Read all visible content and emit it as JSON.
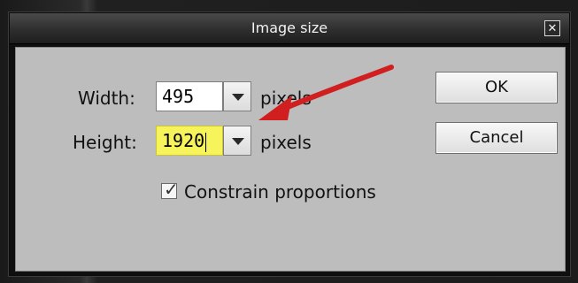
{
  "dialog": {
    "title": "Image size",
    "close_label": "✕"
  },
  "form": {
    "width_label": "Width:",
    "width_value": "495",
    "width_unit": "pixels",
    "height_label": "Height:",
    "height_value": "1920",
    "height_unit": "pixels",
    "constrain_label": "Constrain proportions",
    "constrain_checked": true
  },
  "buttons": {
    "ok_label": "OK",
    "cancel_label": "Cancel"
  },
  "annotation": {
    "arrow_color": "#d11e1e",
    "highlight_color": "#f7f35a",
    "arrow_icon": "red-arrow-annotation"
  }
}
